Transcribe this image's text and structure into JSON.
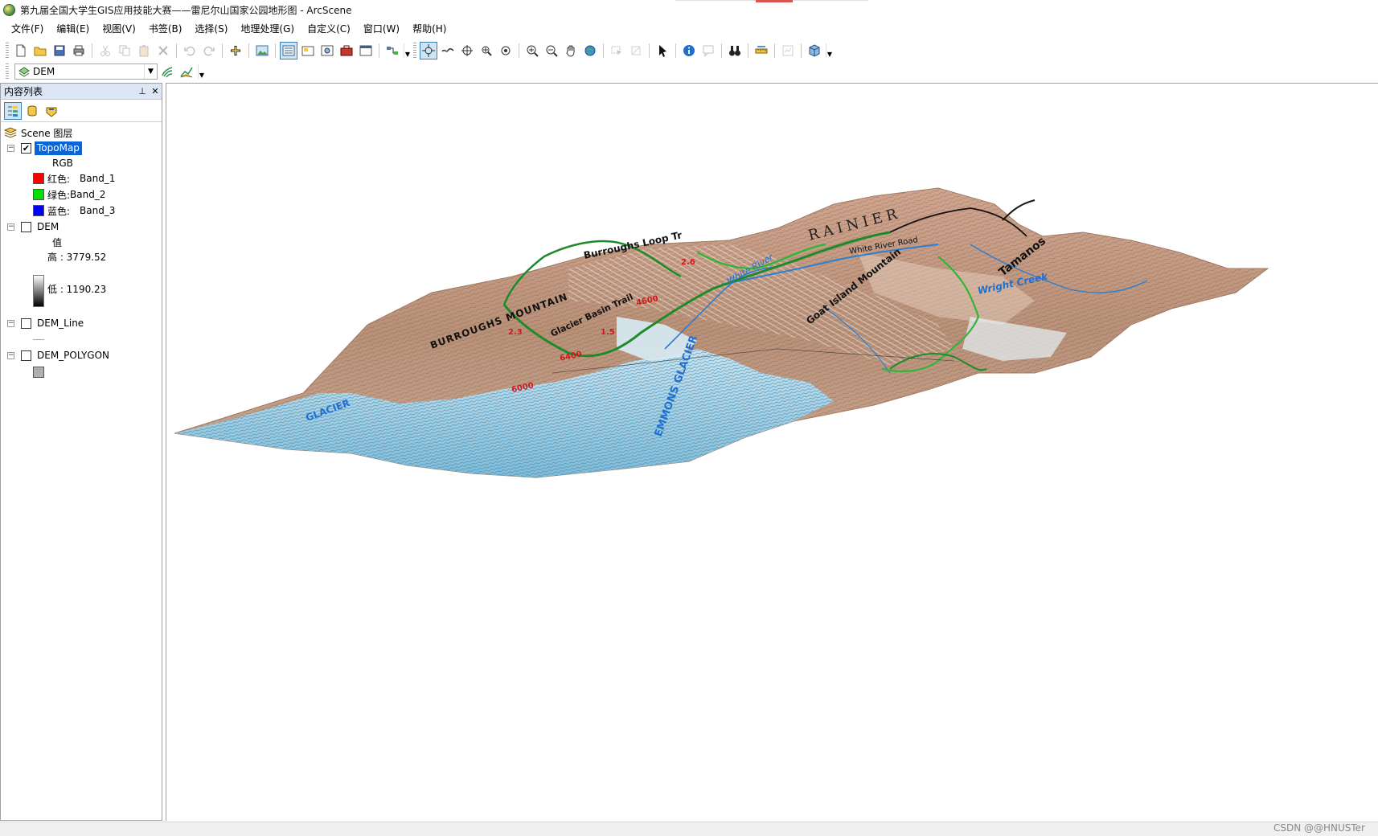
{
  "window": {
    "title": "第九届全国大学生GIS应用技能大赛——雷尼尔山国家公园地形图 - ArcScene"
  },
  "menu": [
    "文件(F)",
    "编辑(E)",
    "视图(V)",
    "书签(B)",
    "选择(S)",
    "地理处理(G)",
    "自定义(C)",
    "窗口(W)",
    "帮助(H)"
  ],
  "layer_combo": {
    "value": "DEM"
  },
  "toc": {
    "title": "内容列表",
    "scene_label": "Scene 图层",
    "layers": {
      "topomap": {
        "name": "TopoMap",
        "checked": true,
        "renderer": "RGB",
        "bands": [
          {
            "label": "红色:",
            "band": "Band_1",
            "color": "#ff0000"
          },
          {
            "label": "绿色:",
            "band": "Band_2",
            "color": "#00e000"
          },
          {
            "label": "蓝色:",
            "band": "Band_3",
            "color": "#0000ff"
          }
        ]
      },
      "dem": {
        "name": "DEM",
        "checked": false,
        "field": "值",
        "high": "高 : 3779.52",
        "low": "低 : 1190.23"
      },
      "dem_line": {
        "name": "DEM_Line",
        "checked": false
      },
      "dem_polygon": {
        "name": "DEM_POLYGON",
        "checked": false,
        "fill_color": "#b0b0b0"
      }
    }
  },
  "scene_map_labels": {
    "rainier": "RAINIER",
    "white_river_road": "White River Road",
    "white_river": "White River",
    "burroughs_loop": "Burroughs Loop Tr",
    "burroughs_mountain": "BURROUGHS MOUNTAIN",
    "goat_island": "Goat Island Mountain",
    "wright_creek": "Wright Creek",
    "tamanos": "Tamanos",
    "glacier_trail": "Glacier Basin Trail",
    "emmons_glacier": "EMMONS GLACIER",
    "glacier_label": "GLACIER",
    "elev_6400": "6400",
    "elev_6000": "6000",
    "elev_4600": "4600",
    "elev_1_5": "1.5",
    "elev_2_3": "2.3",
    "elev_2_6": "2.6"
  },
  "status": {
    "watermark": "CSDN @@HNUSTer"
  }
}
